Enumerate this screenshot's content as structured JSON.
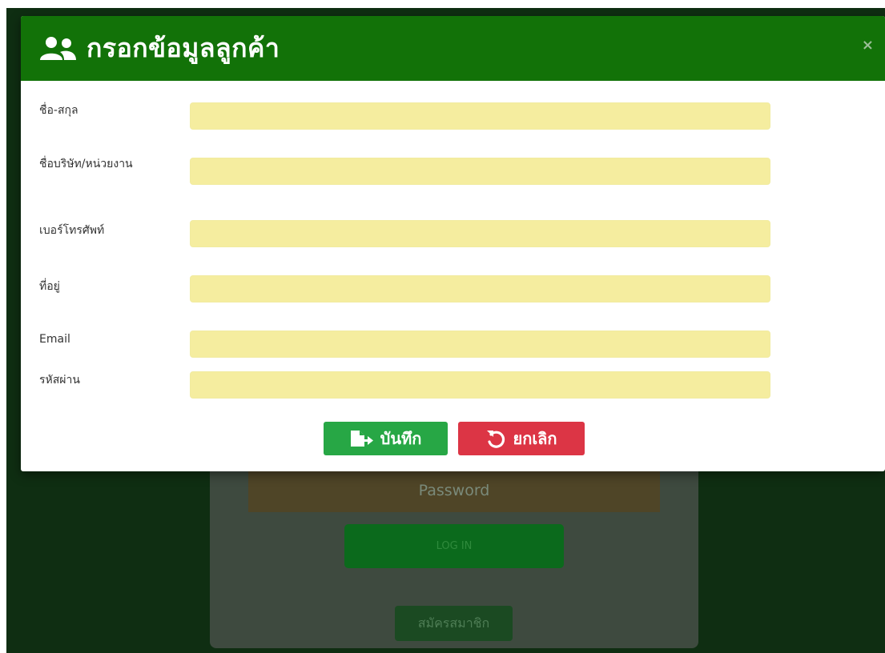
{
  "modal": {
    "title": "กรอกข้อมูลลูกค้า",
    "close_glyph": "×",
    "fields": [
      {
        "label": "ชื่อ-สกุล",
        "value": "",
        "placeholder": ""
      },
      {
        "label": "ชื่อบริษัท/หน่วยงาน",
        "value": "",
        "placeholder": ""
      },
      {
        "label": "เบอร์โทรศัพท์",
        "value": "",
        "placeholder": ""
      },
      {
        "label": "ที่อยู่",
        "value": "",
        "placeholder": ""
      },
      {
        "label": "Email",
        "value": "",
        "placeholder": ""
      },
      {
        "label": "รหัสผ่าน",
        "value": "",
        "placeholder": ""
      }
    ],
    "save_label": "บันทึก",
    "cancel_label": "ยกเลิก"
  },
  "background": {
    "password_placeholder": "Password",
    "login_label": "LOG IN",
    "register_label": "สมัครสมาชิก"
  },
  "icons": {
    "header": "users-icon",
    "save": "sign-in-icon",
    "cancel": "undo-icon",
    "close": "close-icon"
  },
  "colors": {
    "header_green": "#127208",
    "input_yellow": "#f5ed9f",
    "save_green": "#27a745",
    "cancel_red": "#dc3545",
    "backdrop": "#0f2e12"
  }
}
